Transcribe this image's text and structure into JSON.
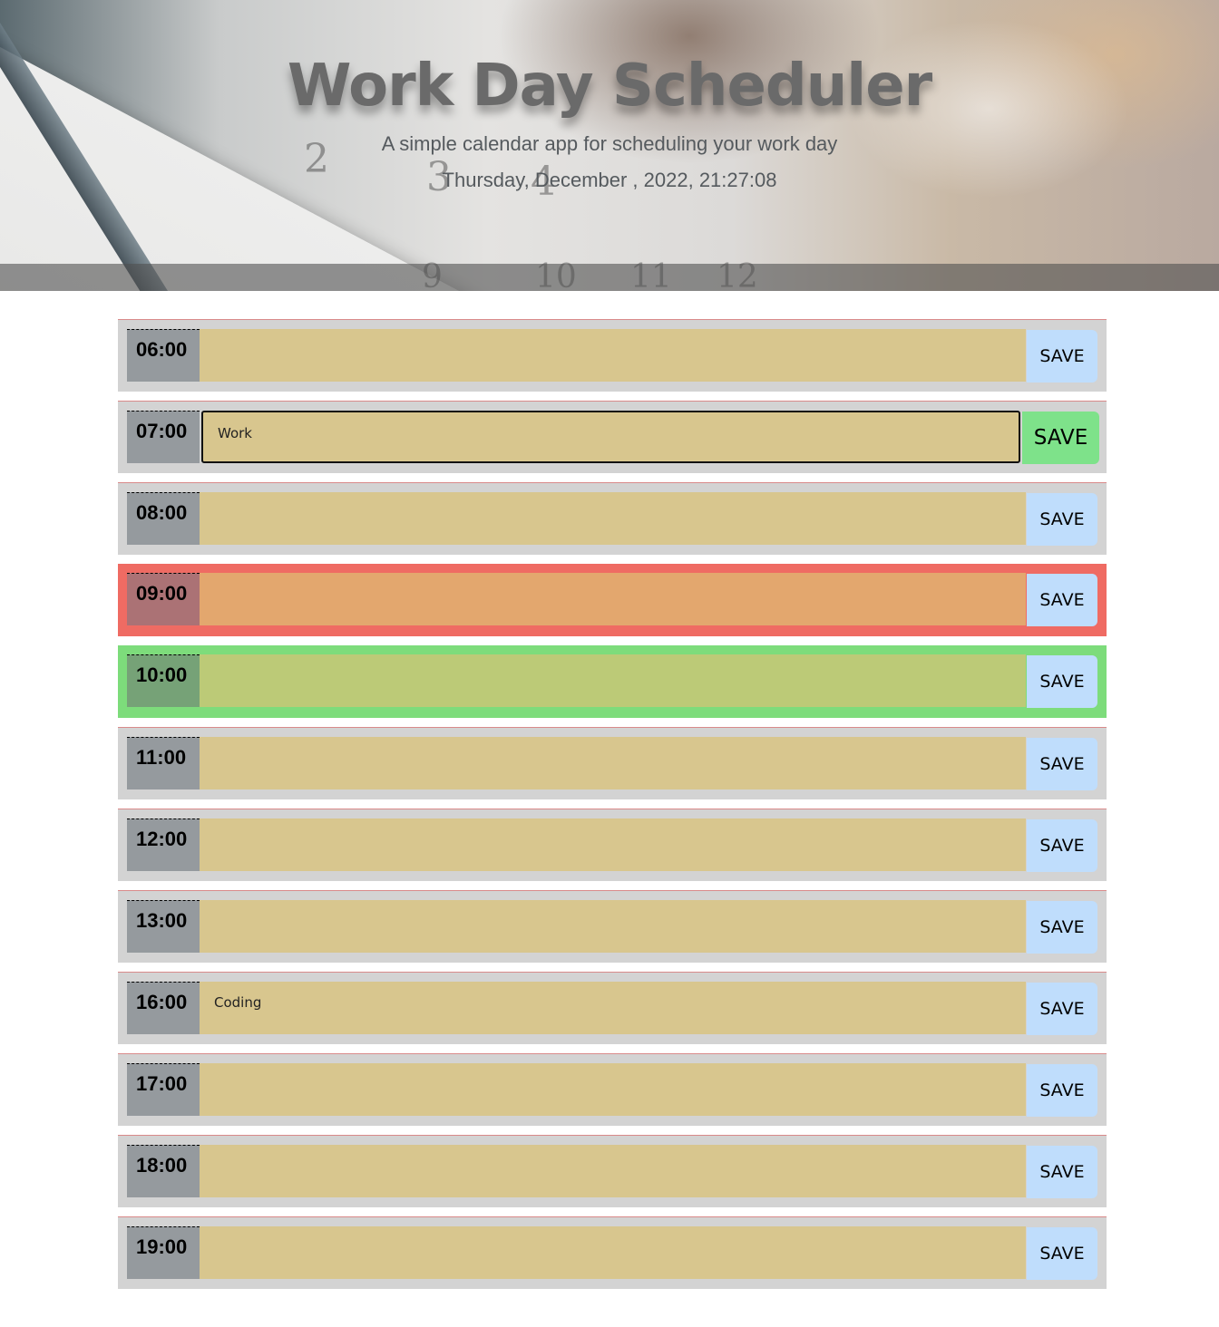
{
  "header": {
    "title": "Work Day Scheduler",
    "subtitle": "A simple calendar app for scheduling your work day",
    "datetime": "Thursday, December , 2022, 21:27:08"
  },
  "save_label": "SAVE",
  "colors": {
    "past": "#d8c68e",
    "present": "#e3a76e",
    "future": "#bcca77",
    "save_button": "#bfddfc",
    "save_button_hover": "#7ee28a"
  },
  "timeblocks": [
    {
      "hour": "06:00",
      "text": "",
      "state": "past"
    },
    {
      "hour": "07:00",
      "text": "Work",
      "state": "past"
    },
    {
      "hour": "08:00",
      "text": "",
      "state": "past"
    },
    {
      "hour": "09:00",
      "text": "",
      "state": "present"
    },
    {
      "hour": "10:00",
      "text": "",
      "state": "future"
    },
    {
      "hour": "11:00",
      "text": "",
      "state": "past"
    },
    {
      "hour": "12:00",
      "text": "",
      "state": "past"
    },
    {
      "hour": "13:00",
      "text": "",
      "state": "past"
    },
    {
      "hour": "16:00",
      "text": "Coding",
      "state": "past"
    },
    {
      "hour": "17:00",
      "text": "",
      "state": "past"
    },
    {
      "hour": "18:00",
      "text": "",
      "state": "past"
    },
    {
      "hour": "19:00",
      "text": "",
      "state": "past"
    }
  ]
}
